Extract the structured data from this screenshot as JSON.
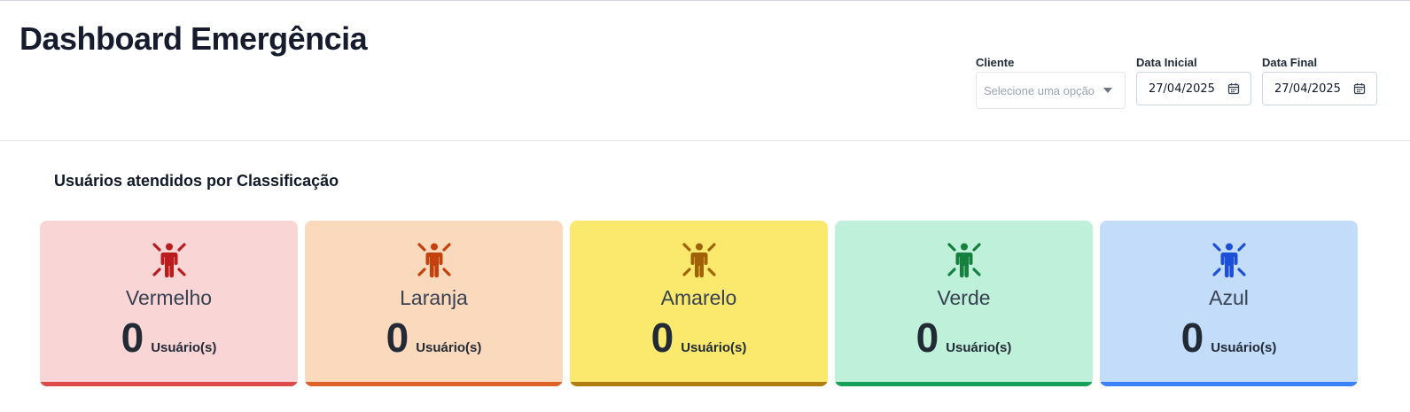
{
  "header": {
    "title": "Dashboard Emergência"
  },
  "filters": {
    "cliente": {
      "label": "Cliente",
      "placeholder": "Selecione uma opção"
    },
    "data_inicial": {
      "label": "Data Inicial",
      "value": "27/04/2025"
    },
    "data_final": {
      "label": "Data Final",
      "value": "27/04/2025"
    }
  },
  "section": {
    "title": "Usuários atendidos por Classificação"
  },
  "cards": [
    {
      "label": "Vermelho",
      "count": "0",
      "unit": "Usuário(s)",
      "bg": "#f9d5d6",
      "icon_color": "#b91c1c",
      "bar": "#dc4a4a",
      "icon": "person-alert-icon"
    },
    {
      "label": "Laranja",
      "count": "0",
      "unit": "Usuário(s)",
      "bg": "#fbd9bd",
      "icon_color": "#c2410c",
      "bar": "#e0602a",
      "icon": "person-alert-icon"
    },
    {
      "label": "Amarelo",
      "count": "0",
      "unit": "Usuário(s)",
      "bg": "#fbe96d",
      "icon_color": "#a16207",
      "bar": "#b07d10",
      "icon": "person-alert-icon"
    },
    {
      "label": "Verde",
      "count": "0",
      "unit": "Usuário(s)",
      "bg": "#bff0da",
      "icon_color": "#15803d",
      "bar": "#16a05a",
      "icon": "person-alert-icon"
    },
    {
      "label": "Azul",
      "count": "0",
      "unit": "Usuário(s)",
      "bg": "#c3dcf9",
      "icon_color": "#1d4ed8",
      "bar": "#3b82f6",
      "icon": "person-alert-icon"
    }
  ]
}
